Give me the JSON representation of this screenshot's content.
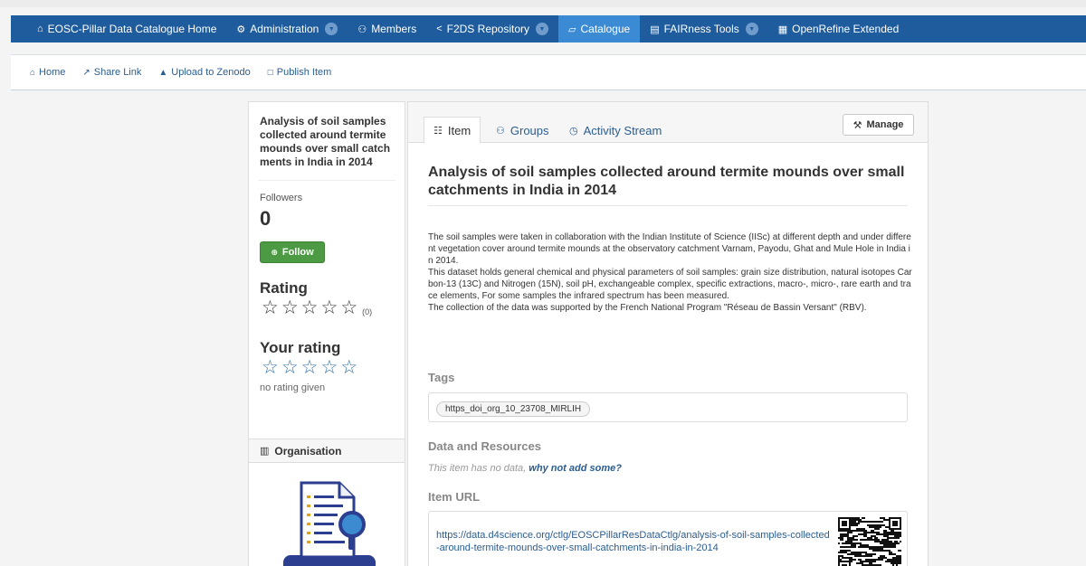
{
  "navbar": {
    "items": [
      {
        "label": "EOSC-Pillar Data Catalogue Home",
        "icon": "home-icon",
        "glyph": "⌂",
        "caret": false,
        "active": false
      },
      {
        "label": "Administration",
        "icon": "gear-icon",
        "glyph": "⚙",
        "caret": true,
        "active": false
      },
      {
        "label": "Members",
        "icon": "users-icon",
        "glyph": "⚇",
        "caret": false,
        "active": false
      },
      {
        "label": "F2DS Repository",
        "icon": "share-icon",
        "glyph": "<",
        "caret": true,
        "active": false
      },
      {
        "label": "Catalogue",
        "icon": "book-icon",
        "glyph": "▱",
        "caret": false,
        "active": true
      },
      {
        "label": "FAIRness Tools",
        "icon": "clipboard-icon",
        "glyph": "▤",
        "caret": true,
        "active": false
      },
      {
        "label": "OpenRefine Extended",
        "icon": "table-icon",
        "glyph": "▦",
        "caret": false,
        "active": false
      }
    ]
  },
  "subnav": {
    "items": [
      {
        "label": "Home",
        "icon": "home-icon",
        "glyph": "⌂"
      },
      {
        "label": "Share Link",
        "icon": "share-link-icon",
        "glyph": "↗"
      },
      {
        "label": "Upload to Zenodo",
        "icon": "upload-icon",
        "glyph": "▲"
      },
      {
        "label": "Publish Item",
        "icon": "document-icon",
        "glyph": "□"
      }
    ]
  },
  "sidebar": {
    "title": "Analysis of soil samples collected around termite mounds over small catchments in India in 2014",
    "followers_label": "Followers",
    "followers_count": "0",
    "follow_label": "Follow",
    "rating_label": "Rating",
    "rating_count": "(0)",
    "your_rating_label": "Your rating",
    "no_rating": "no rating given",
    "organisation_label": "Organisation"
  },
  "tabs": {
    "item": "Item",
    "groups": "Groups",
    "activity": "Activity Stream",
    "manage": "Manage"
  },
  "content": {
    "title": "Analysis of soil samples collected around termite mounds over small catchments in India in 2014",
    "description": [
      "The soil samples were taken in collaboration with the Indian Institute of Science (IISc) at different depth and under different vegetation cover around termite mounds at the observatory catchment Varnam, Payodu, Ghat and Mule Hole in India in 2014.",
      "This dataset holds general chemical and physical parameters of soil samples: grain size distribution, natural isotopes Carbon-13 (13C) and Nitrogen (15N), soil pH, exchangeable complex, specific extractions, macro-, micro-, rare earth and trace elements, For some samples the infrared spectrum has been measured.",
      "The collection of the data was supported by the French National Program \"Réseau de Bassin Versant\" (RBV)."
    ],
    "tags_label": "Tags",
    "tag": "https_doi_org_10_23708_MIRLIH",
    "data_resources_label": "Data and Resources",
    "no_data_text": "This item has no data,",
    "no_data_link": "why not add some?",
    "item_url_label": "Item URL",
    "item_url": "https://data.d4science.org/ctlg/EOSCPillarResDataCtlg/analysis-of-soil-samples-collected-around-termite-mounds-over-small-catchments-in-india-in-2014"
  },
  "colors": {
    "navbar": "#1f5c9e",
    "navbar_active": "#3a8ad4",
    "follow_button": "#4c9a43",
    "link": "#2a5d92"
  }
}
